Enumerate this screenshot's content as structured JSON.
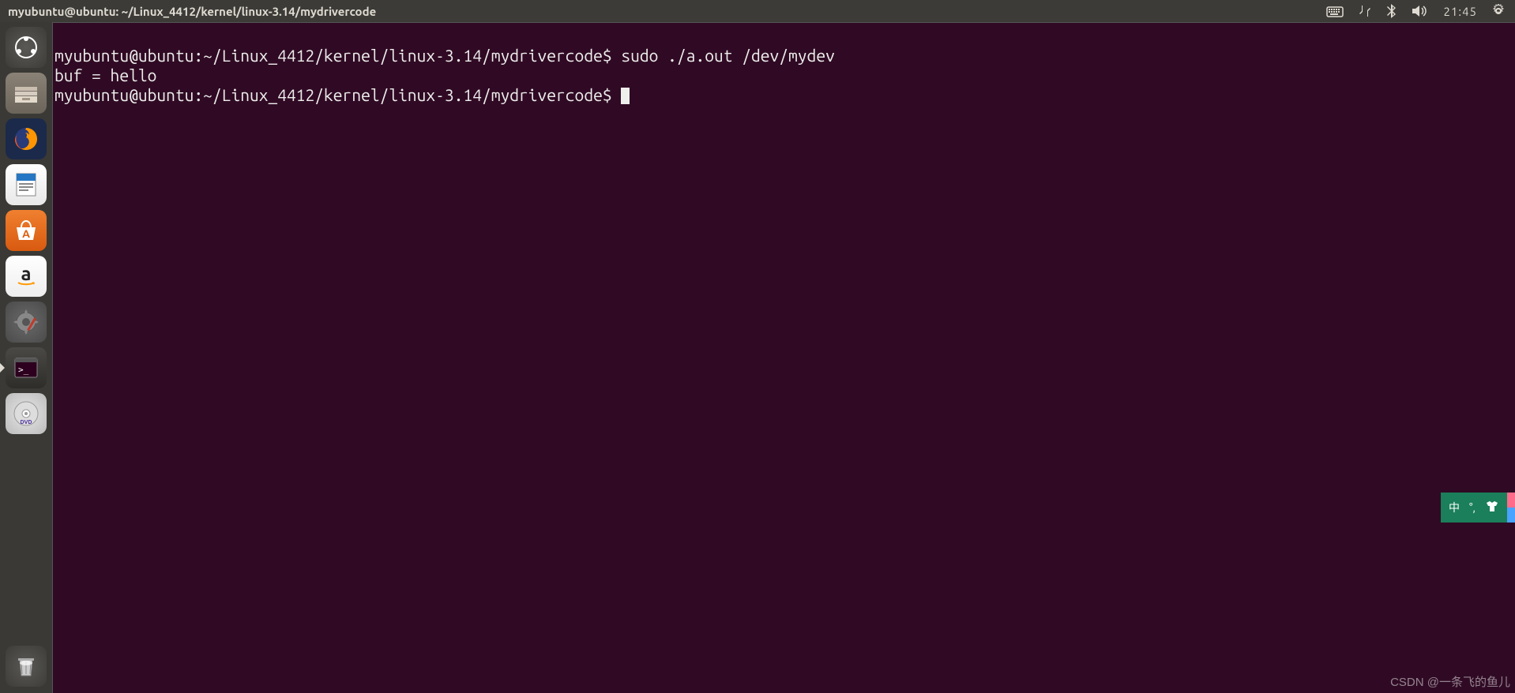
{
  "menubar": {
    "title": "myubuntu@ubuntu: ~/Linux_4412/kernel/linux-3.14/mydrivercode",
    "clock": "21:45"
  },
  "launcher": {
    "items": [
      {
        "name": "dash-icon"
      },
      {
        "name": "files-icon"
      },
      {
        "name": "firefox-icon"
      },
      {
        "name": "writer-icon"
      },
      {
        "name": "software-center-icon"
      },
      {
        "name": "amazon-icon"
      },
      {
        "name": "settings-icon"
      },
      {
        "name": "terminal-icon"
      },
      {
        "name": "disc-icon"
      }
    ],
    "trash": {
      "name": "trash-icon"
    }
  },
  "terminal": {
    "line1_prompt": "myubuntu@ubuntu:~/Linux_4412/kernel/linux-3.14/mydrivercode$ ",
    "line1_cmd": "sudo ./a.out /dev/mydev",
    "line2": "buf = hello",
    "line3_prompt": "myubuntu@ubuntu:~/Linux_4412/kernel/linux-3.14/mydrivercode$ "
  },
  "ime": {
    "lang": "中",
    "punct": "°,",
    "shirt": "👕"
  },
  "watermark": "CSDN @一条飞的鱼儿"
}
